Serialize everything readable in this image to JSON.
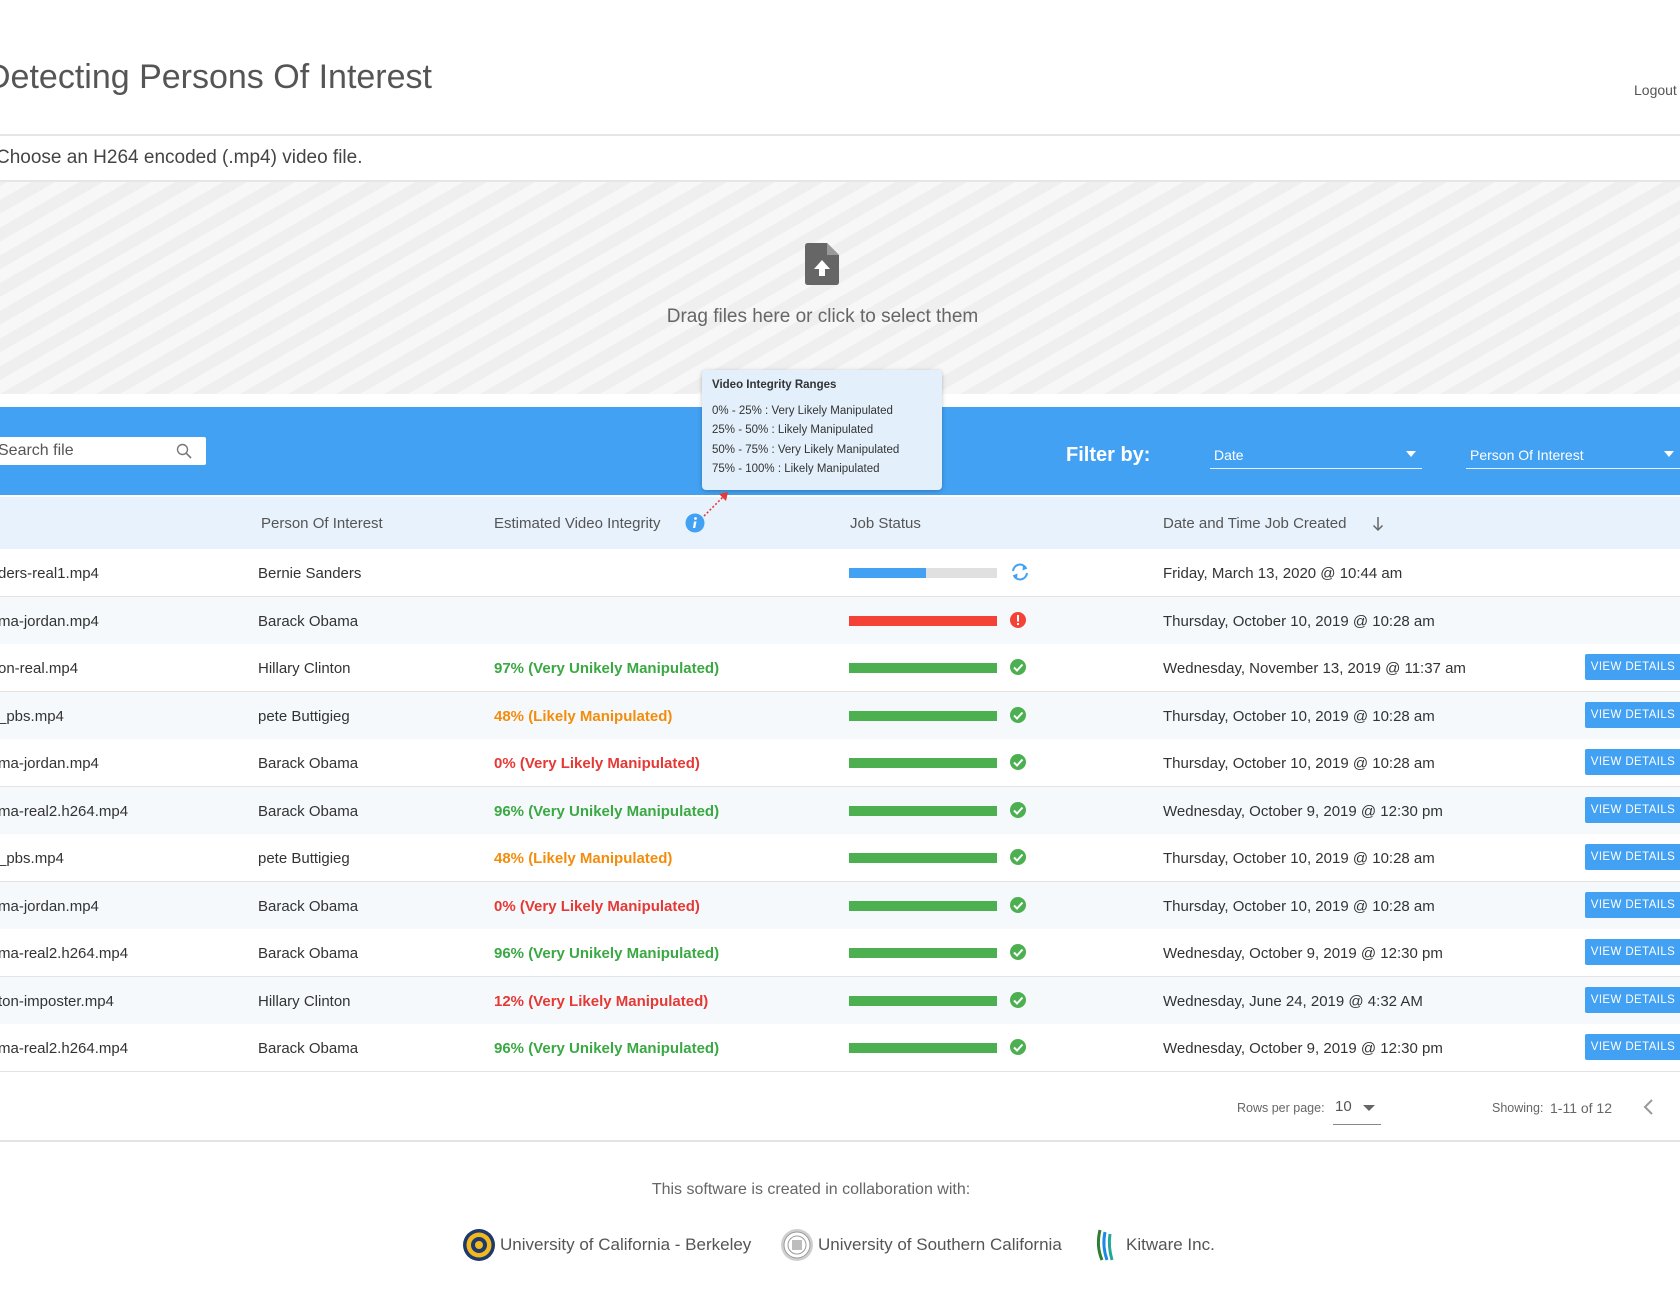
{
  "header": {
    "title": "Detecting Persons Of Interest",
    "logout_label": "Logout"
  },
  "upload": {
    "instruction": "Choose an H264 encoded (.mp4) video file.",
    "dropzone_text": "Drag files here or click to select them"
  },
  "toolbar": {
    "search_placeholder": "Search file",
    "filter_label": "Filter by:",
    "filter_date": "Date",
    "filter_poi": "Person Of Interest"
  },
  "tooltip": {
    "title": "Video Integrity Ranges",
    "lines": [
      "0% - 25% : Very Likely Manipulated",
      "25% - 50% : Likely Manipulated",
      "50% - 75% : Very Likely Manipulated",
      "75% - 100% : Likely Manipulated"
    ]
  },
  "table": {
    "headers": {
      "person": "Person Of Interest",
      "integrity": "Estimated Video Integrity",
      "status": "Job Status",
      "date": "Date and Time Job Created"
    },
    "view_details_label": "VIEW DETAILS",
    "rows": [
      {
        "file": "ders-real1.mp4",
        "person": "Bernie Sanders",
        "integrity": "",
        "level": "",
        "status": "processing",
        "progress": 0.52,
        "date": "Friday, March 13, 2020 @ 10:44 am",
        "has_button": false
      },
      {
        "file": "ma-jordan.mp4",
        "person": "Barack Obama",
        "integrity": "",
        "level": "",
        "status": "error",
        "progress": 1.0,
        "date": "Thursday, October 10, 2019 @ 10:28 am",
        "has_button": false
      },
      {
        "file": "on-real.mp4",
        "person": "Hillary Clinton",
        "integrity": "97% (Very Unikely Manipulated)",
        "level": "good",
        "status": "done",
        "progress": 1.0,
        "date": "Wednesday, November 13, 2019 @ 11:37 am",
        "has_button": true
      },
      {
        "file": "_pbs.mp4",
        "person": "pete Buttigieg",
        "integrity": "48% (Likely Manipulated)",
        "level": "warn",
        "status": "done",
        "progress": 1.0,
        "date": "Thursday, October 10, 2019 @ 10:28 am",
        "has_button": true
      },
      {
        "file": "ma-jordan.mp4",
        "person": "Barack Obama",
        "integrity": "0% (Very Likely Manipulated)",
        "level": "bad",
        "status": "done",
        "progress": 1.0,
        "date": "Thursday, October 10, 2019 @ 10:28 am",
        "has_button": true
      },
      {
        "file": "ma-real2.h264.mp4",
        "person": "Barack Obama",
        "integrity": "96% (Very Unikely Manipulated)",
        "level": "good",
        "status": "done",
        "progress": 1.0,
        "date": "Wednesday, October 9, 2019 @ 12:30 pm",
        "has_button": true
      },
      {
        "file": "_pbs.mp4",
        "person": "pete Buttigieg",
        "integrity": "48% (Likely Manipulated)",
        "level": "warn",
        "status": "done",
        "progress": 1.0,
        "date": "Thursday, October 10, 2019 @ 10:28 am",
        "has_button": true
      },
      {
        "file": "ma-jordan.mp4",
        "person": "Barack Obama",
        "integrity": "0% (Very Likely Manipulated)",
        "level": "bad",
        "status": "done",
        "progress": 1.0,
        "date": "Thursday, October 10, 2019 @ 10:28 am",
        "has_button": true
      },
      {
        "file": "ma-real2.h264.mp4",
        "person": "Barack Obama",
        "integrity": "96% (Very Unikely Manipulated)",
        "level": "good",
        "status": "done",
        "progress": 1.0,
        "date": "Wednesday, October 9, 2019 @ 12:30 pm",
        "has_button": true
      },
      {
        "file": "ton-imposter.mp4",
        "person": "Hillary Clinton",
        "integrity": "12% (Very Likely Manipulated)",
        "level": "bad",
        "status": "done",
        "progress": 1.0,
        "date": "Wednesday, June 24, 2019 @ 4:32 AM",
        "has_button": true
      },
      {
        "file": "ma-real2.h264.mp4",
        "person": "Barack Obama",
        "integrity": "96% (Very Unikely Manipulated)",
        "level": "good",
        "status": "done",
        "progress": 1.0,
        "date": "Wednesday, October 9, 2019 @ 12:30 pm",
        "has_button": true
      }
    ]
  },
  "pagination": {
    "rows_per_page_label": "Rows per page:",
    "rows_per_page_value": "10",
    "showing_label": "Showing:",
    "showing_value": "1-11 of 12"
  },
  "footer": {
    "collab_text": "This software is created in collaboration with:",
    "partners": [
      {
        "name": "University of California - Berkeley",
        "icon": "berkeley-seal-icon"
      },
      {
        "name": "University of Southern California",
        "icon": "usc-seal-icon"
      },
      {
        "name": "Kitware Inc.",
        "icon": "kitware-logo-icon"
      }
    ]
  },
  "colors": {
    "accent": "#42a1f2",
    "good": "#3aa843",
    "warn": "#f48c0b",
    "bad": "#e53935",
    "bar_done": "#4caf50",
    "bar_error": "#f44336",
    "bar_processing": "#42a1f2"
  },
  "icons": {
    "upload": "file-upload-icon",
    "search": "search-icon",
    "info": "info-icon",
    "sort": "arrow-down-icon",
    "processing": "sync-icon",
    "error": "error-icon",
    "done": "check-circle-icon",
    "prev": "chevron-left-icon"
  }
}
